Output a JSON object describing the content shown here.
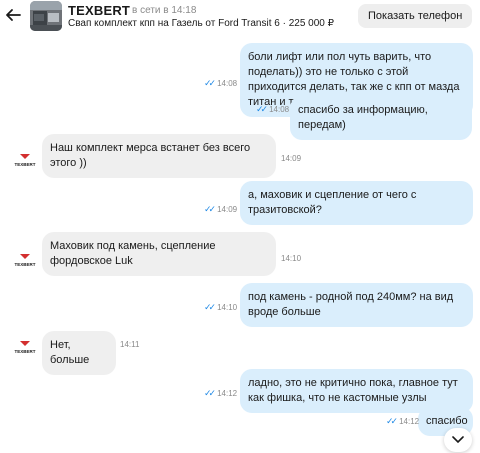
{
  "header": {
    "seller_name": "TEXBERT",
    "seller_status": "в сети в 14:18",
    "listing": "Свап комплект кпп на Газель от Ford Transit 6 · 225 000 ₽",
    "phone_button": "Показать телефон",
    "back_icon": "arrow-left-icon"
  },
  "avatar_text": "TEXBERT",
  "messages": [
    {
      "dir": "out",
      "text": "боли лифт или пол чуть варить, что поделать)) это не только с этой приходится делать, так же с кпп от мазда титан и т.д.",
      "time": "14:08",
      "read": true
    },
    {
      "dir": "out",
      "text": "спасибо за информацию, передам)",
      "time": "14:08",
      "read": true
    },
    {
      "dir": "in",
      "text": "Наш комплект мерса встанет без всего этого ))",
      "time": "14:09"
    },
    {
      "dir": "out",
      "text": "а, маховик и сцепление от чего с тразитовской?",
      "time": "14:09",
      "read": true
    },
    {
      "dir": "in",
      "text": "Маховик под камень, сцепление фордовское Luk",
      "time": "14:10"
    },
    {
      "dir": "out",
      "text": "под камень - родной под 240мм? на вид вроде больше",
      "time": "14:10",
      "read": true
    },
    {
      "dir": "in",
      "text": "Нет, больше",
      "time": "14:11"
    },
    {
      "dir": "out",
      "text": "ладно, это не критично пока, главное тут как фишка, что не кастомные узлы",
      "time": "14:12",
      "read": true
    },
    {
      "dir": "out",
      "text": "спасибо",
      "time": "14:12",
      "read": true
    }
  ],
  "colors": {
    "outgoing_bubble": "#daeefc",
    "incoming_bubble": "#efefef",
    "read_tick": "#1e88e5",
    "brand_red": "#d32f2f"
  },
  "scroll_icon": "chevron-down-icon"
}
